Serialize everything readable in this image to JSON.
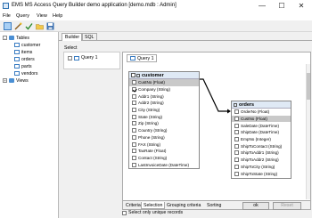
{
  "window": {
    "title": "EMS MS Access Query Builder demo application [demo.mdb : Admin]",
    "controls": [
      "—",
      "☐",
      "✕"
    ]
  },
  "menu": [
    "File",
    "Query",
    "View",
    "Help"
  ],
  "tree": {
    "tables_label": "Tables",
    "tables": [
      "customer",
      "items",
      "orders",
      "parts",
      "vendors"
    ],
    "views_label": "Views"
  },
  "tabs": {
    "builder": "Builder",
    "sql": "SQL"
  },
  "select_label": "Select",
  "query_outline_item": "Query 1",
  "canvas_tab": "Query 1",
  "customer": {
    "name": "customer",
    "fields": [
      {
        "label": "CustNo (Float)",
        "checked": false,
        "selected": true
      },
      {
        "label": "Company (String)",
        "checked": true,
        "selected": false
      },
      {
        "label": "Addr1 (String)",
        "checked": false,
        "selected": false
      },
      {
        "label": "Addr2 (String)",
        "checked": false,
        "selected": false
      },
      {
        "label": "City (String)",
        "checked": false,
        "selected": false
      },
      {
        "label": "State (String)",
        "checked": false,
        "selected": false
      },
      {
        "label": "Zip (String)",
        "checked": false,
        "selected": false
      },
      {
        "label": "Country (String)",
        "checked": false,
        "selected": false
      },
      {
        "label": "Phone (String)",
        "checked": false,
        "selected": false
      },
      {
        "label": "FAX (String)",
        "checked": false,
        "selected": false
      },
      {
        "label": "TaxRate (Float)",
        "checked": false,
        "selected": false
      },
      {
        "label": "Contact (String)",
        "checked": false,
        "selected": false
      },
      {
        "label": "LastInvoiceDate (DateTime)",
        "checked": false,
        "selected": false
      }
    ]
  },
  "orders": {
    "name": "orders",
    "fields": [
      {
        "label": "OrderNo (Float)",
        "checked": false,
        "selected": false
      },
      {
        "label": "CustNo (Float)",
        "checked": false,
        "selected": true
      },
      {
        "label": "SaleDate (DateTime)",
        "checked": false,
        "selected": false
      },
      {
        "label": "ShipDate (DateTime)",
        "checked": false,
        "selected": false
      },
      {
        "label": "EmpNo (Integer)",
        "checked": false,
        "selected": false
      },
      {
        "label": "ShipToContact (String)",
        "checked": false,
        "selected": false
      },
      {
        "label": "ShipToAddr1 (String)",
        "checked": false,
        "selected": false
      },
      {
        "label": "ShipToAddr2 (String)",
        "checked": false,
        "selected": false
      },
      {
        "label": "ShipToCity (String)",
        "checked": false,
        "selected": false
      },
      {
        "label": "ShipToState (String)",
        "checked": false,
        "selected": false
      }
    ]
  },
  "bottom_tabs": [
    "Criteria",
    "Selection",
    "Grouping criteria",
    "Sorting"
  ],
  "unique_records_label": "Select only unique records",
  "buttons": {
    "ok": "ok",
    "reset": "Reset"
  }
}
